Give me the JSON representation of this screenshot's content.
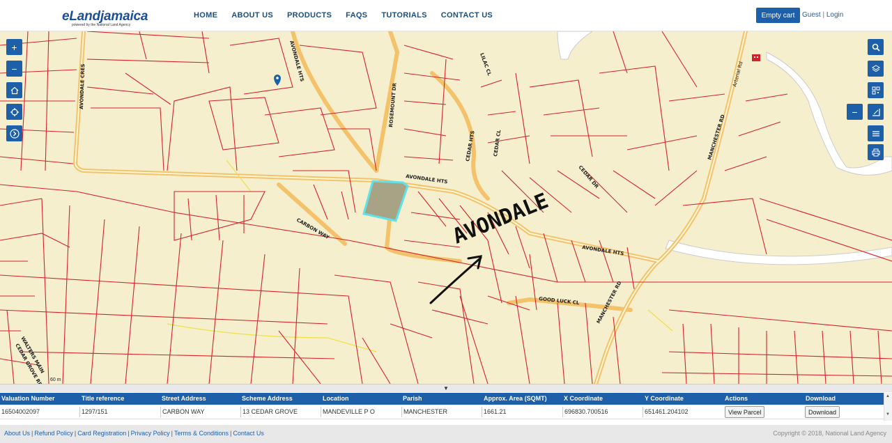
{
  "header": {
    "brand": "eLandjamaica",
    "tagline": "powered by the National Land Agency",
    "nav": [
      "HOME",
      "ABOUT US",
      "PRODUCTS",
      "FAQS",
      "TUTORIALS",
      "CONTACT US"
    ],
    "cart_label": "Empty cart",
    "guest_label": "Guest",
    "login_label": "Login"
  },
  "map": {
    "road_labels": {
      "avondale_cres": "AVONDALE CRES",
      "avondale_hts_nw": "AVONDALE HTS",
      "rosemount_dr": "ROSEMOUNT DR",
      "lilac_cl": "LILAC CL",
      "cedar_hts": "CEDAR HTS",
      "cedar_cl": "CEDAR CL",
      "avondale_hts_mid": "AVONDALE HTS",
      "cedar_dr": "CEDAR DR",
      "manchester_rd": "MANCHESTER RD",
      "carbon_way": "CARBON WAY",
      "avondale_hts_e": "AVONDALE HTS",
      "good_luck_cl": "GOOD LUCK CL",
      "manchester_rd_s": "MANCHESTER RD",
      "arterial_rd": "Arterial Rd",
      "walters_main": "WALTERS MAIN",
      "cedar_grove": "CEDAR GROVE RD"
    },
    "annotation": "AVONDALE",
    "scale": "60 m",
    "left_tools": [
      "zoom-in",
      "zoom-out",
      "home",
      "locate",
      "next"
    ],
    "right_tools": [
      "search",
      "layers",
      "qr",
      "measure",
      "list",
      "print"
    ]
  },
  "collapse_arrow": "▼",
  "table": {
    "headers": [
      "Valuation Number",
      "Title reference",
      "Street Address",
      "Scheme Address",
      "Location",
      "Parish",
      "Approx. Area (SQMT)",
      "X Coordinate",
      "Y Coordinate",
      "Actions",
      "Download"
    ],
    "rows": [
      {
        "valuation": "16504002097",
        "title": "1297/151",
        "street": "CARBON WAY",
        "scheme": "13 CEDAR GROVE",
        "location": "MANDEVILLE P O",
        "parish": "MANCHESTER",
        "area": "1661.21",
        "x": "696830.700516",
        "y": "651461.204102",
        "action": "View Parcel",
        "download": "Download"
      }
    ]
  },
  "footer": {
    "links": [
      "About Us",
      "Refund Policy",
      "Card Registration",
      "Privacy Policy",
      "Terms & Conditions",
      "Contact Us"
    ],
    "copyright": "Copyright © 2018, National Land Agency"
  }
}
